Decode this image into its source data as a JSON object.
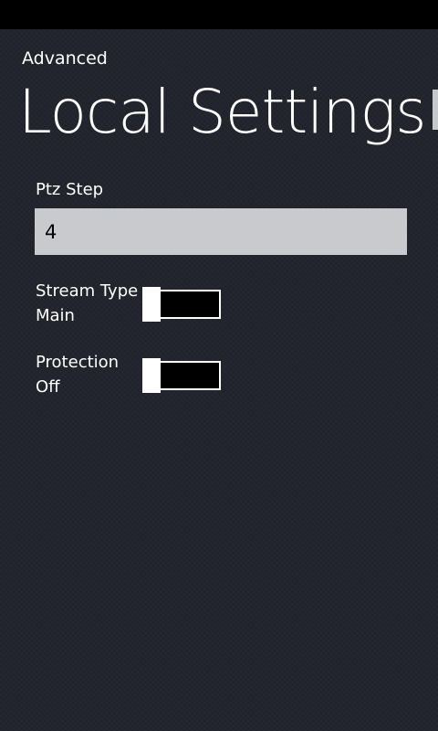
{
  "app": {
    "title": "Advanced"
  },
  "page": {
    "title": "Local Settings"
  },
  "ptz_step": {
    "label": "Ptz Step",
    "value": "4"
  },
  "stream_type": {
    "label": "Stream Type",
    "state": "Main",
    "is_on": false
  },
  "protection": {
    "label": "Protection",
    "state": "Off",
    "is_on": false
  },
  "colors": {
    "background": "#23252e",
    "status_bar": "#000000",
    "text": "#ffffff",
    "input_background": "#c9cacd",
    "toggle_track": "#000000",
    "toggle_thumb": "#ffffff"
  }
}
